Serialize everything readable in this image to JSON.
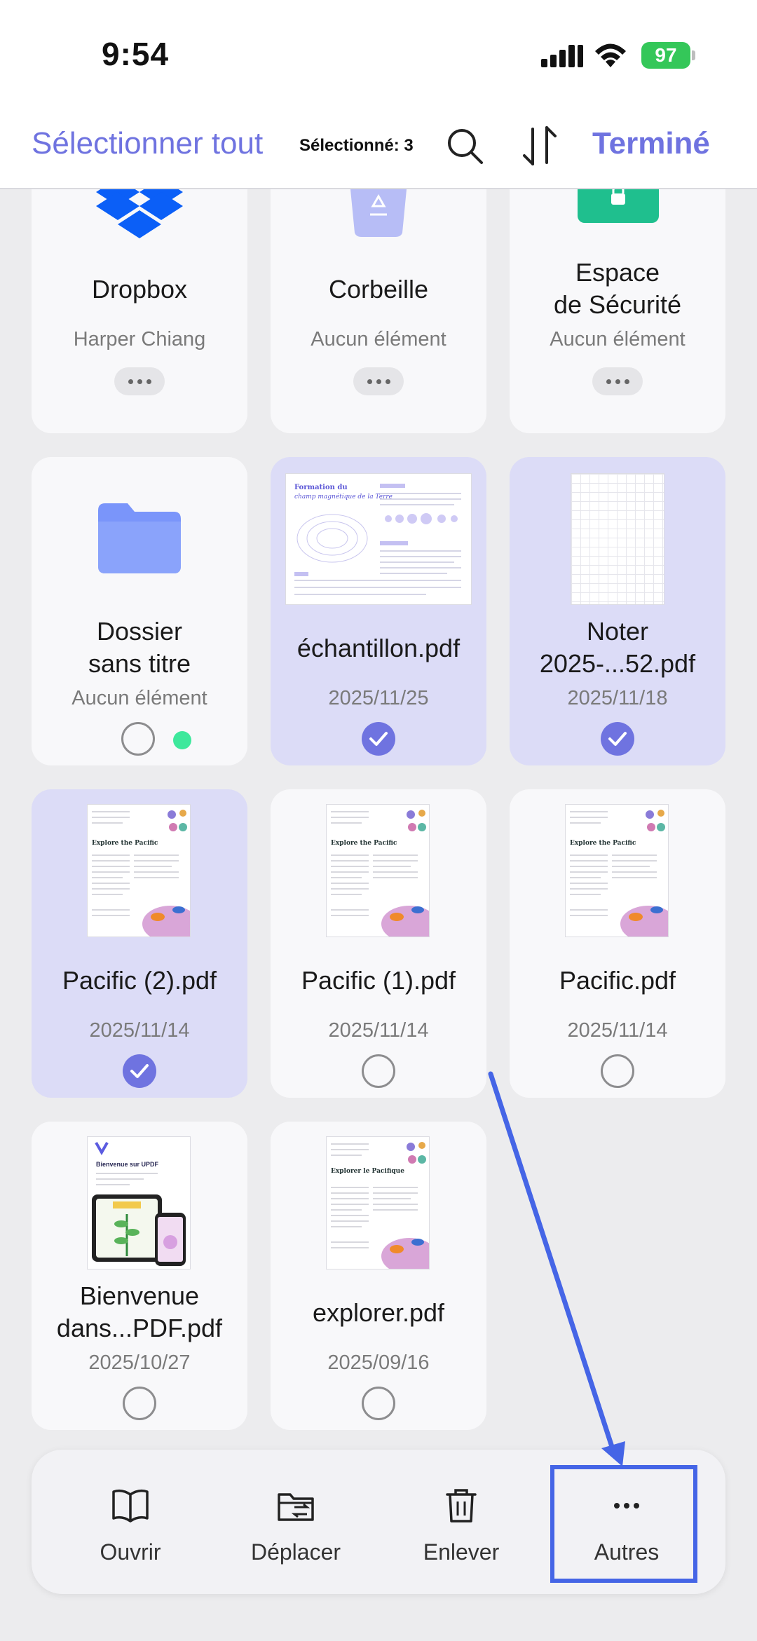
{
  "status": {
    "time": "9:54",
    "battery": "97"
  },
  "toolbar": {
    "select_all": "Sélectionner tout",
    "selected_count": "Sélectionné: 3",
    "done": "Terminé"
  },
  "colors": {
    "accent": "#6f73e0",
    "selected_bg": "#dcdcf7",
    "annotation": "#4565e6",
    "green": "#3ee89c"
  },
  "items": [
    {
      "title": "Dropbox",
      "sub": "Harper Chiang",
      "icon": "dropbox-icon"
    },
    {
      "title": "Corbeille",
      "sub": "Aucun élément",
      "icon": "trash-bin-icon"
    },
    {
      "title_line1": "Espace",
      "title_line2": "de Sécurité",
      "sub": "Aucun élément",
      "icon": "lock-icon"
    },
    {
      "title_line1": "Dossier",
      "title_line2": "sans titre",
      "sub": "Aucun élément",
      "icon": "folder-icon",
      "selected": false
    },
    {
      "title": "échantillon.pdf",
      "date": "2025/11/25",
      "selected": true
    },
    {
      "title_line1": "Noter",
      "title_line2": "2025-...52.pdf",
      "date": "2025/11/18",
      "selected": true
    },
    {
      "title": "Pacific (2).pdf",
      "date": "2025/11/14",
      "selected": true
    },
    {
      "title": "Pacific (1).pdf",
      "date": "2025/11/14",
      "selected": false
    },
    {
      "title": "Pacific.pdf",
      "date": "2025/11/14",
      "selected": false
    },
    {
      "title_line1": "Bienvenue",
      "title_line2": "dans...PDF.pdf",
      "date": "2025/10/27",
      "selected": false
    },
    {
      "title": "explorer.pdf",
      "date": "2025/09/16",
      "selected": false
    }
  ],
  "thumbs": {
    "sample_title1": "Formation du",
    "sample_title2": "champ magnétique de la Terre",
    "pacific_head": "Explore the Pacific",
    "welcome_head": "Bienvenue sur UPDF",
    "explorer_head": "Explorer le Pacifique"
  },
  "actions": [
    {
      "label": "Ouvrir",
      "icon": "book-open-icon"
    },
    {
      "label": "Déplacer",
      "icon": "folder-move-icon"
    },
    {
      "label": "Enlever",
      "icon": "trash-icon"
    },
    {
      "label": "Autres",
      "icon": "more-horizontal-icon"
    }
  ]
}
